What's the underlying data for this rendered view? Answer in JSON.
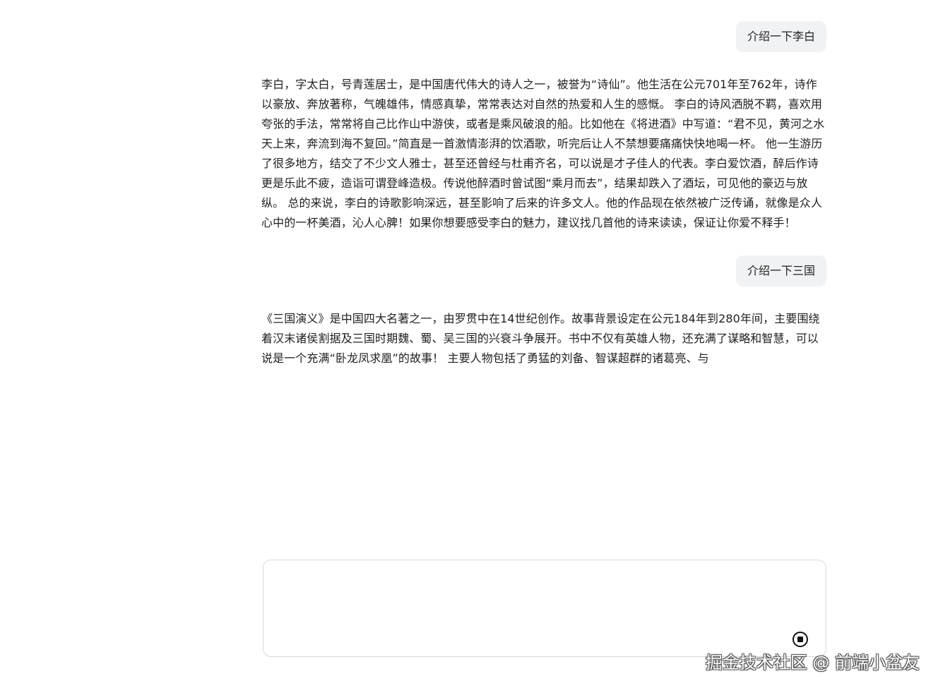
{
  "conversation": {
    "messages": [
      {
        "role": "user",
        "text": "介绍一下李白"
      },
      {
        "role": "assistant",
        "text": "李白，字太白，号青莲居士，是中国唐代伟大的诗人之一，被誉为“诗仙”。他生活在公元701年至762年，诗作以豪放、奔放著称，气魄雄伟，情感真挚，常常表达对自然的热爱和人生的感慨。 李白的诗风洒脱不羁，喜欢用夸张的手法，常常将自己比作山中游侠，或者是乘风破浪的船。比如他在《将进酒》中写道：“君不见，黄河之水天上来，奔流到海不复回。”简直是一首激情澎湃的饮酒歌，听完后让人不禁想要痛痛快快地喝一杯。 他一生游历了很多地方，结交了不少文人雅士，甚至还曾经与杜甫齐名，可以说是才子佳人的代表。李白爱饮酒，醉后作诗更是乐此不疲，造诣可谓登峰造极。传说他醉酒时曾试图“乘月而去”，结果却跌入了酒坛，可见他的豪迈与放纵。 总的来说，李白的诗歌影响深远，甚至影响了后来的许多文人。他的作品现在依然被广泛传诵，就像是众人心中的一杯美酒，沁人心脾！如果你想要感受李白的魅力，建议找几首他的诗来读读，保证让你爱不释手！"
      },
      {
        "role": "user",
        "text": "介绍一下三国"
      },
      {
        "role": "assistant",
        "text": "《三国演义》是中国四大名著之一，由罗贯中在14世纪创作。故事背景设定在公元184年到280年间，主要围绕着汉末诸侯割据及三国时期魏、蜀、吴三国的兴衰斗争展开。书中不仅有英雄人物，还充满了谋略和智慧，可以说是一个充满“卧龙凤求凰”的故事！ 主要人物包括了勇猛的刘备、智谋超群的诸葛亮、与"
      }
    ]
  },
  "composer": {
    "value": "",
    "stop_icon": "stop-circle-icon"
  },
  "watermark": "掘金技术社区 @ 前端小盆友"
}
